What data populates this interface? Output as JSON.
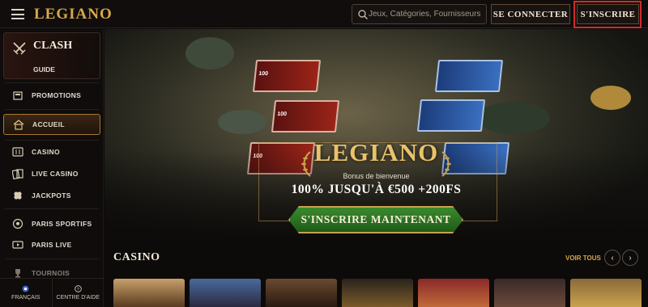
{
  "header": {
    "logo": "LEGIANO",
    "search_placeholder": "Jeux, Catégories, Fournisseurs",
    "login_label": "SE CONNECTER",
    "signup_label": "S'INSCRIRE"
  },
  "sidebar": {
    "clash": {
      "title": "CLASH",
      "guide": "GUIDE"
    },
    "items": [
      {
        "label": "PROMOTIONS",
        "icon": "promotions-icon"
      },
      {
        "label": "ACCUEIL",
        "icon": "home-icon",
        "active": true
      },
      {
        "label": "CASINO",
        "icon": "slot-machine-icon"
      },
      {
        "label": "LIVE CASINO",
        "icon": "cards-icon"
      },
      {
        "label": "JACKPOTS",
        "icon": "clover-icon"
      },
      {
        "label": "PARIS SPORTIFS",
        "icon": "football-icon"
      },
      {
        "label": "PARIS LIVE",
        "icon": "live-icon"
      },
      {
        "label": "TOURNOIS",
        "icon": "trophy-icon"
      }
    ],
    "bottom": {
      "language": "FRANÇAIS",
      "help": "CENTRE D'AIDE"
    }
  },
  "hero": {
    "logo": "LEGIANO",
    "subtitle": "Bonus de bienvenue",
    "offer": "100% JUSQU'À €500 +200FS",
    "cta": "S'INSCRIRE MAINTENANT",
    "card_numbers": [
      "100",
      "100",
      "100"
    ]
  },
  "casino": {
    "title": "CASINO",
    "see_all": "VOIR TOUS"
  },
  "colors": {
    "accent_gold": "#d6a84a",
    "cta_green": "#2e7a22",
    "highlight_red": "#d42a2a"
  }
}
